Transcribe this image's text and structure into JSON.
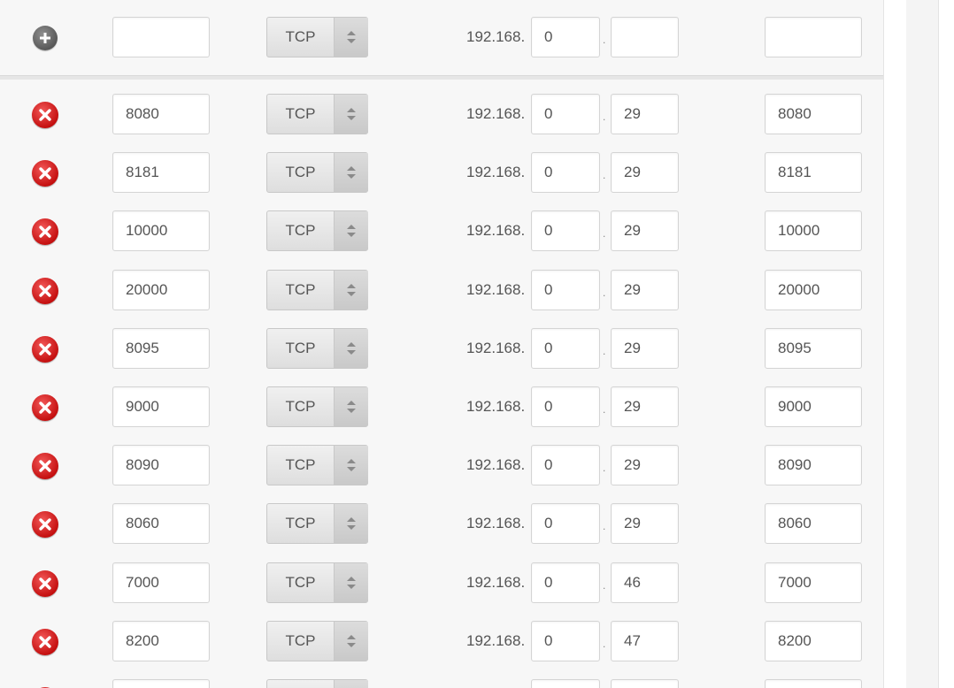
{
  "new_row": {
    "add_icon": "plus-circle-icon",
    "ext_port": "",
    "protocol": "TCP",
    "ip_prefix": "192.168.",
    "ip_part3": "0",
    "ip_part4": "",
    "int_port": ""
  },
  "rows": [
    {
      "ext_port": "8080",
      "protocol": "TCP",
      "ip_prefix": "192.168.",
      "ip_part3": "0",
      "ip_part4": "29",
      "int_port": "8080"
    },
    {
      "ext_port": "8181",
      "protocol": "TCP",
      "ip_prefix": "192.168.",
      "ip_part3": "0",
      "ip_part4": "29",
      "int_port": "8181"
    },
    {
      "ext_port": "10000",
      "protocol": "TCP",
      "ip_prefix": "192.168.",
      "ip_part3": "0",
      "ip_part4": "29",
      "int_port": "10000"
    },
    {
      "ext_port": "20000",
      "protocol": "TCP",
      "ip_prefix": "192.168.",
      "ip_part3": "0",
      "ip_part4": "29",
      "int_port": "20000"
    },
    {
      "ext_port": "8095",
      "protocol": "TCP",
      "ip_prefix": "192.168.",
      "ip_part3": "0",
      "ip_part4": "29",
      "int_port": "8095"
    },
    {
      "ext_port": "9000",
      "protocol": "TCP",
      "ip_prefix": "192.168.",
      "ip_part3": "0",
      "ip_part4": "29",
      "int_port": "9000"
    },
    {
      "ext_port": "8090",
      "protocol": "TCP",
      "ip_prefix": "192.168.",
      "ip_part3": "0",
      "ip_part4": "29",
      "int_port": "8090"
    },
    {
      "ext_port": "8060",
      "protocol": "TCP",
      "ip_prefix": "192.168.",
      "ip_part3": "0",
      "ip_part4": "29",
      "int_port": "8060"
    },
    {
      "ext_port": "7000",
      "protocol": "TCP",
      "ip_prefix": "192.168.",
      "ip_part3": "0",
      "ip_part4": "46",
      "int_port": "7000"
    },
    {
      "ext_port": "8200",
      "protocol": "TCP",
      "ip_prefix": "192.168.",
      "ip_part3": "0",
      "ip_part4": "47",
      "int_port": "8200"
    },
    {
      "ext_port": "",
      "protocol": "",
      "ip_prefix": "",
      "ip_part3": "",
      "ip_part4": "",
      "int_port": ""
    }
  ],
  "ip_separator": ".",
  "icons": {
    "remove": "remove-circle-icon",
    "select_arrows": "up-down-arrows-icon"
  },
  "colors": {
    "remove_red": "#d81c1c",
    "add_gray": "#6a6a6a",
    "background": "#f7f7f7"
  }
}
